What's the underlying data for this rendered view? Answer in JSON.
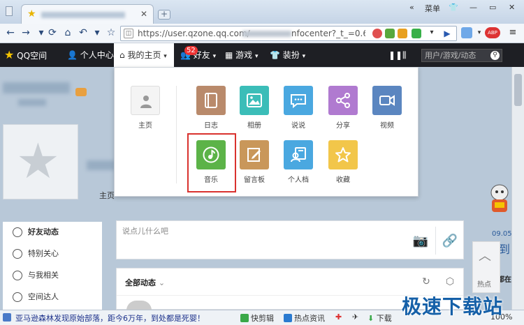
{
  "browser": {
    "tab_close": "✕",
    "new_tab": "+",
    "window_menu_label": "菜单",
    "url_text": "https://user.qzone.qq.com/",
    "url_tail": "nfocenter?_t_=0.608",
    "extension_badge": "ABP"
  },
  "qqbar": {
    "logo_label": "QQ空间",
    "personal_center": "个人中心",
    "home_tab": "我的主页",
    "friends_label": "好友",
    "friends_badge": "52",
    "games_label": "游戏",
    "decor_label": "装扮",
    "search_placeholder": "用户/游戏/动态"
  },
  "dropdown": {
    "main_label": "主页",
    "apps_row1": [
      "日志",
      "相册",
      "说说",
      "分享",
      "视频"
    ],
    "apps_row2": [
      "音乐",
      "留言板",
      "个人档",
      "收藏"
    ],
    "colors": {
      "diary": "#b98a6b",
      "album": "#3bbdb8",
      "shuoshuo": "#4aa8e0",
      "share": "#b07ad0",
      "video": "#5b86c0",
      "music": "#5cb348",
      "board": "#c9975a",
      "profile": "#4aa8e0",
      "favorite": "#f2c64a",
      "highlight": "#d9322e"
    }
  },
  "profile": {
    "main_label": "主页"
  },
  "sidebar": {
    "items": [
      "好友动态",
      "特别关心",
      "与我相关",
      "空间达人"
    ]
  },
  "post": {
    "placeholder": "说点儿什么吧"
  },
  "feed": {
    "filter_label": "全部动态"
  },
  "right": {
    "date": "09.05",
    "partial_char": "到",
    "partial_text": "都在",
    "hotspot_label": "热点"
  },
  "statusbar": {
    "ticker": "亚马逊森林发现原始部落，距今6万年，到处都是死婴！",
    "quick_edit": "快剪辑",
    "hot_news": "热点资讯",
    "download": "下载",
    "zoom": "100%"
  },
  "watermark": "极速下载站"
}
